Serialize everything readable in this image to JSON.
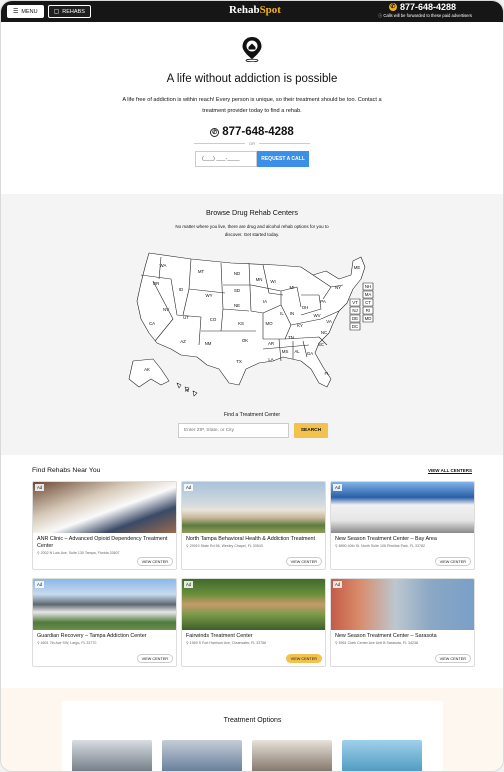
{
  "topbar": {
    "menu_label": "MENU",
    "rehabs_label": "REHABS",
    "logo_part1": "Rehab",
    "logo_part2": "Spot",
    "phone": "877-648-4288",
    "forward_note": "Calls will be forwarded to these paid advertisers"
  },
  "hero": {
    "title": "A life without addiction is possible",
    "body": "A life free of addiction is within reach! Every person is unique, so their treatment should be too. Contact a treatment provider today to find a rehab.",
    "phone": "877-648-4288",
    "or": "OR",
    "phone_placeholder": "(___) ___-____",
    "request_button": "REQUEST A CALL"
  },
  "browse": {
    "title": "Browse Drug Rehab Centers",
    "subtitle": "No matter where you live, there are drug and alcohol rehab options for you to discover. Get started today.",
    "states": [
      "WA",
      "OR",
      "CA",
      "ID",
      "NV",
      "AZ",
      "MT",
      "WY",
      "UT",
      "CO",
      "NM",
      "TX",
      "ND",
      "SD",
      "NE",
      "KS",
      "OK",
      "MN",
      "IA",
      "MO",
      "AR",
      "LA",
      "WI",
      "IL",
      "MI",
      "IN",
      "OH",
      "KY",
      "TN",
      "MS",
      "AL",
      "GA",
      "FL",
      "SC",
      "NC",
      "VA",
      "WV",
      "PA",
      "NY",
      "ME",
      "AK",
      "HI",
      "NH",
      "MA",
      "VT",
      "CT",
      "NJ",
      "RI",
      "DE",
      "MD",
      "DC"
    ],
    "find_label": "Find a Treatment Center",
    "zip_placeholder": "Enter ZIP, State, or City",
    "search_button": "SEARCH"
  },
  "rehabs": {
    "title": "Find Rehabs Near You",
    "view_all": "VIEW ALL CENTERS",
    "ad_label": "Ad",
    "cards": [
      {
        "name": "ANR Clinic – Advanced Opioid Dependency Treatment Center",
        "address": "2002 N Lois Ave, Suite 130 Tampa, Florida 33607",
        "button": "VIEW CENTER"
      },
      {
        "name": "North Tampa Behavioral Health & Addiction Treatment",
        "address": "29910 State Rd 56, Wesley Chapel, FL 33543",
        "button": "VIEW CENTER"
      },
      {
        "name": "New Season Treatment Center – Bay Area",
        "address": "8890 40th St. North Suite 106 Pinellas Park, FL 33782",
        "button": "VIEW CENTER"
      },
      {
        "name": "Guardian Recovery – Tampa Addiction Center",
        "address": "4601 7th Ave SW, Largo, FL 33770",
        "button": "VIEW CENTER"
      },
      {
        "name": "Fairwinds Treatment Center",
        "address": "1569 S Fort Harrison Ave, Clearwater, FL 33756",
        "button": "VIEW CENTER"
      },
      {
        "name": "New Season Treatment Center – Sarasota",
        "address": "5951 Clark Center Ave Unit B Sarasota, FL 34238",
        "button": "VIEW CENTER"
      }
    ]
  },
  "treatment": {
    "title": "Treatment Options"
  }
}
